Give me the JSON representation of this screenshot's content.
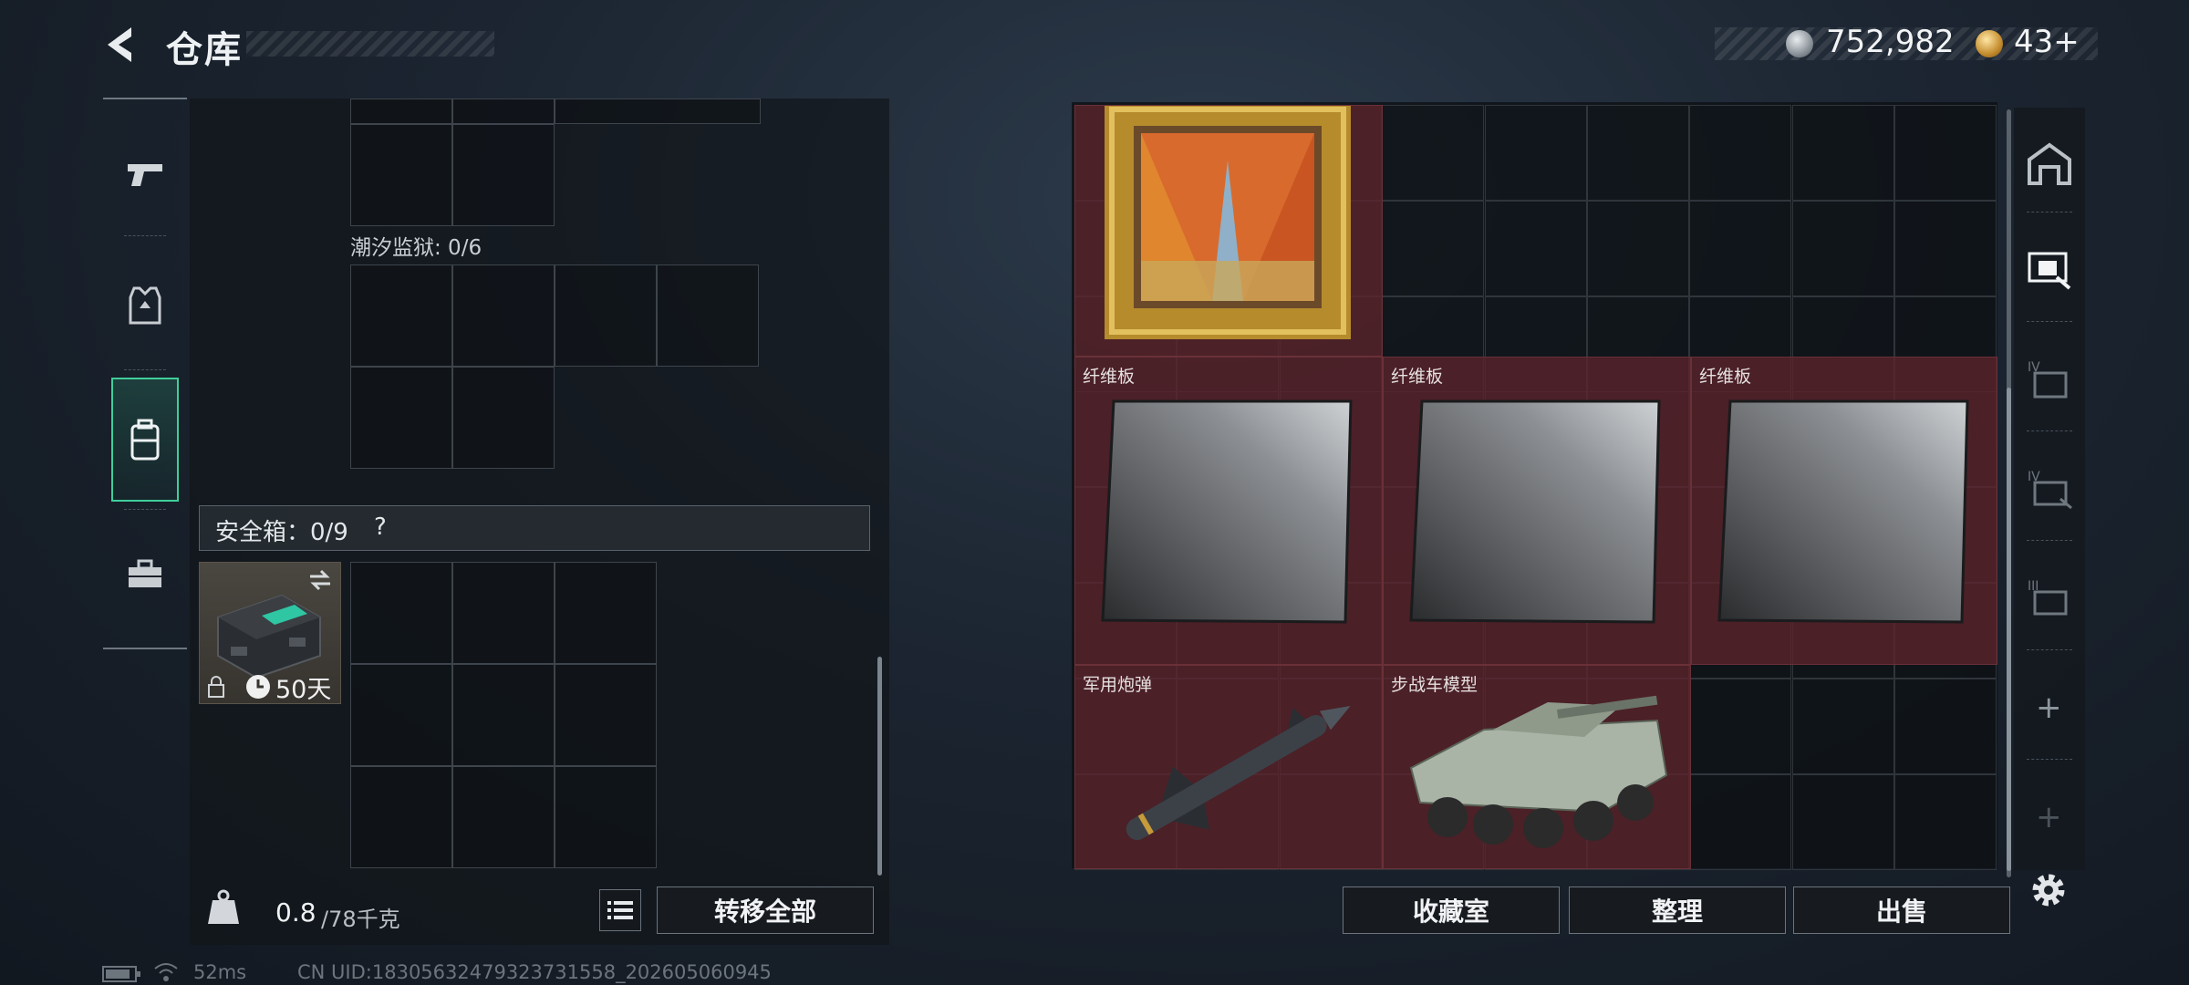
{
  "header": {
    "title": "仓库",
    "currency_main": "752,982",
    "currency_bonds": "43+"
  },
  "left_panel": {
    "prison_label": "潮汐监狱: 0/6",
    "safebox_label": "安全箱：0/9",
    "safebox_help": "?",
    "case_days": "50天",
    "weight_current": "0.8",
    "weight_max": "/78千克",
    "transfer_all_label": "转移全部"
  },
  "stash": {
    "items": [
      {
        "label": "",
        "kind": "painting"
      },
      {
        "label": "纤维板",
        "kind": "carbon-panel"
      },
      {
        "label": "纤维板",
        "kind": "carbon-panel"
      },
      {
        "label": "纤维板",
        "kind": "carbon-panel"
      },
      {
        "label": "军用炮弹",
        "kind": "missile"
      },
      {
        "label": "步战车模型",
        "kind": "ifv-model"
      }
    ],
    "collection_label": "收藏室",
    "sort_label": "整理",
    "sell_label": "出售"
  },
  "right_rail": {
    "plus_label": "+"
  },
  "status_bar": {
    "ping": "52ms",
    "uid": "CN UID:1830563247932373​1558_202605060945"
  },
  "colors": {
    "accent_green": "#3fcf9a",
    "item_bg_red": "#5c242c"
  }
}
